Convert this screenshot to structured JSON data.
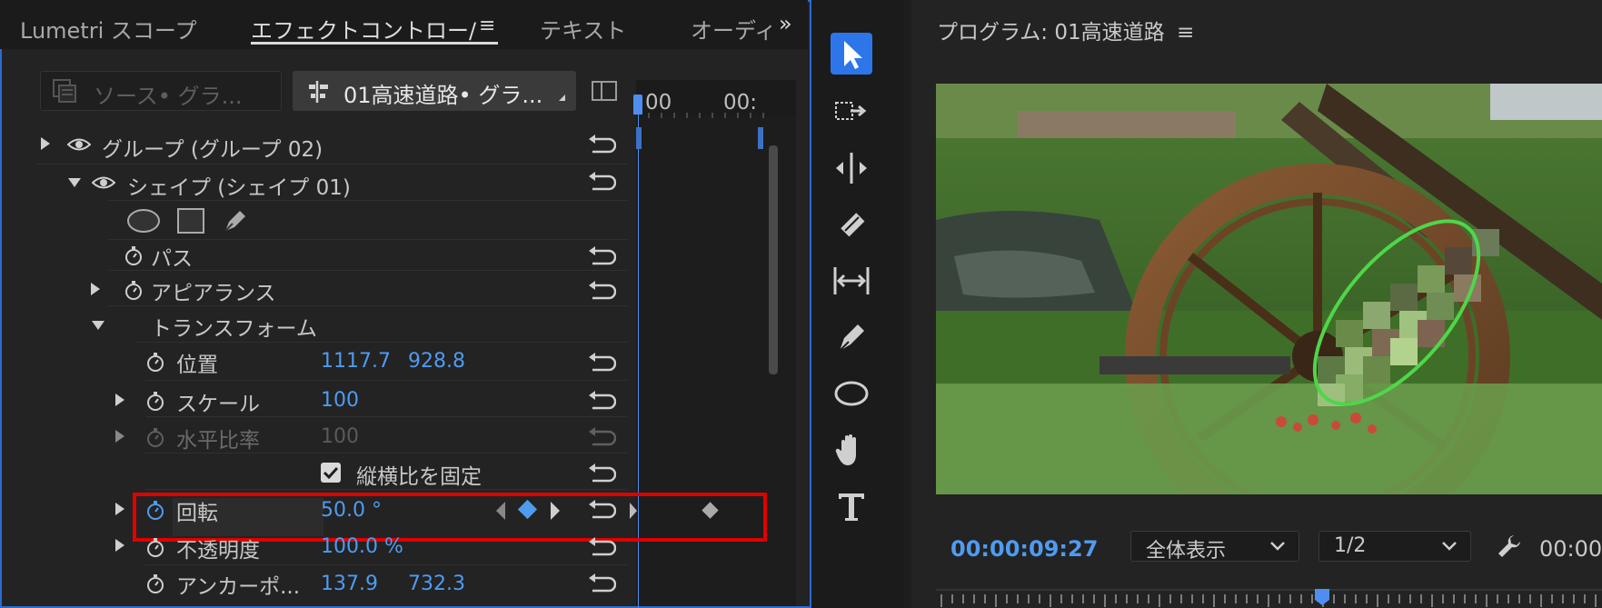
{
  "left_panel": {
    "tabs": [
      {
        "label": "Lumetri スコープ",
        "active": false
      },
      {
        "label": "エフェクトコントロー/",
        "active": true
      },
      {
        "label": "テキスト",
        "active": false
      },
      {
        "label": "オーディ",
        "active": false
      }
    ],
    "tab_menu_glyph": "≡",
    "overflow_glyph": "»",
    "source_button": "ソース• グラ...",
    "sequence_button": "01高速道路• グラ...",
    "timeline_labels": [
      "00",
      "00:"
    ],
    "rows": {
      "group": "グループ (グループ 02)",
      "shape": "シェイプ (シェイプ 01)",
      "path": "パス",
      "appearance": "アピアランス",
      "transform": "トランスフォーム",
      "position_label": "位置",
      "position_x": "1117.7",
      "position_y": "928.8",
      "scale_label": "スケール",
      "scale_value": "100",
      "hscale_label": "水平比率",
      "hscale_value": "100",
      "lock_aspect_label": "縦横比を固定",
      "lock_aspect_checked": true,
      "rotation_label": "回転",
      "rotation_value": "50.0 °",
      "opacity_label": "不透明度",
      "opacity_value": "100.0 %",
      "anchor_label": "アンカーポ...",
      "anchor_x": "137.9",
      "anchor_y": "732.3"
    }
  },
  "program": {
    "title": "プログラム: 01高速道路",
    "menu_glyph": "≡",
    "timecode": "00:00:09:27",
    "zoom_select": "全体表示",
    "resolution_select": "1/2",
    "timecode_right": "00:00"
  },
  "colors": {
    "accent": "#2d76ea",
    "value_blue": "#4f9bf0",
    "highlight_red": "#e00000",
    "ellipse_green": "#4fd64a"
  }
}
